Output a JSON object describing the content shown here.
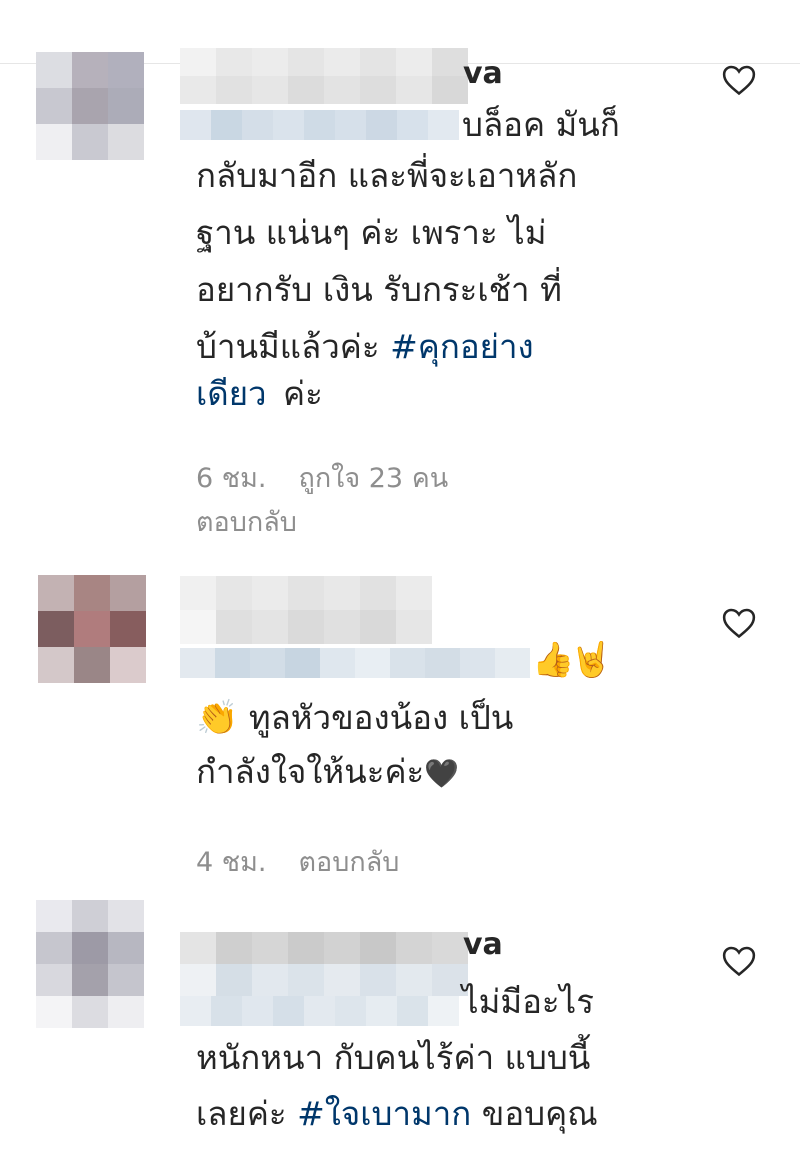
{
  "comments": [
    {
      "username_tail": "va",
      "line1_tail": "บล็อค มันก็",
      "body_lines": "กลับมาอีก และพี่จะเอาหลัก\nฐาน แน่นๆ ค่ะ เพราะ ไม่\nอยากรับ เงิน รับกระเช้า ที่\nบ้านมีแล้วค่ะ ",
      "hashtag": "#คุกอย่าง",
      "hashtag_line2": "เดียว",
      "end": " ค่ะ",
      "time": "6 ชม.",
      "likes": "ถูกใจ 23 คน",
      "reply": "ตอบกลับ"
    },
    {
      "line_emojis": "👍🤘",
      "clap": "👏",
      "body1": " ทูลหัวของน้อง เป็น",
      "body2": "กำลังใจให้นะค่ะ",
      "heart_emoji": "🖤",
      "time": "4 ชม.",
      "reply": "ตอบกลับ"
    },
    {
      "username_tail": "va",
      "line1_tail": "ไม่มีอะไร",
      "body1": "หนักหนา กับคนไร้ค่า แบบนี้",
      "body2_prefix": "เลยค่ะ ",
      "hashtag": "#ใจเบามาก",
      "body2_suffix": " ขอบคุณ"
    }
  ],
  "icons": {
    "like": "heart-outline-icon"
  },
  "colors": {
    "text": "#262626",
    "meta": "#8e8e8e",
    "hashtag": "#00376b"
  }
}
